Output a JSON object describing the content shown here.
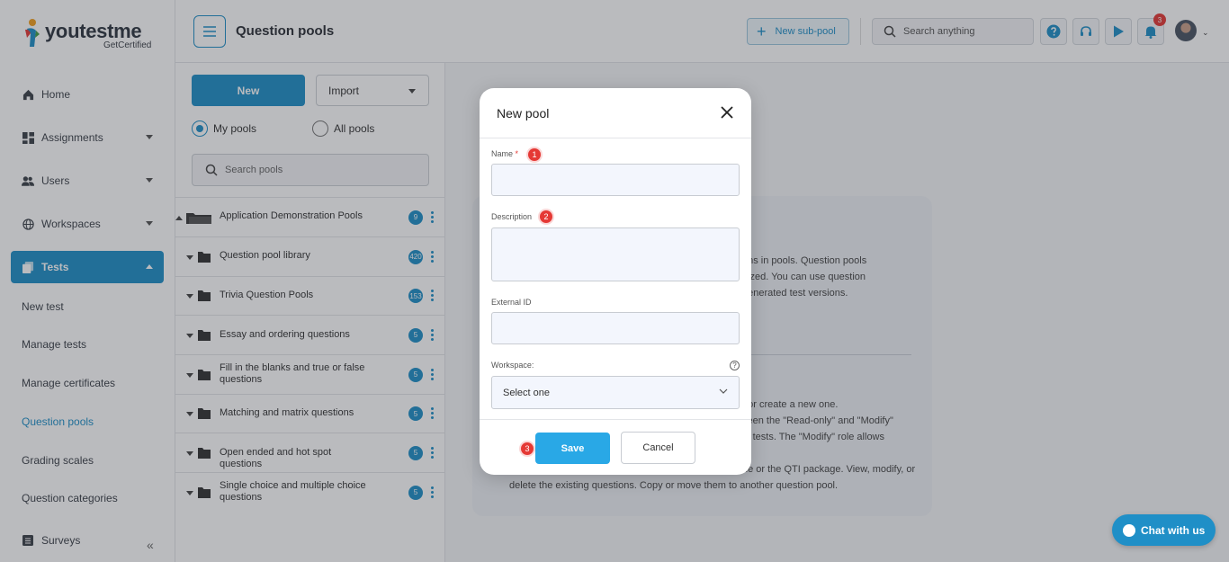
{
  "brand": {
    "name": "youtestme",
    "tagline": "GetCertified"
  },
  "header": {
    "title": "Question pools",
    "new_subpool": "New sub-pool",
    "search_placeholder": "Search anything",
    "notifications_count": "3"
  },
  "sidebar": {
    "items": [
      {
        "label": "Home"
      },
      {
        "label": "Assignments"
      },
      {
        "label": "Users"
      },
      {
        "label": "Workspaces"
      },
      {
        "label": "Tests"
      },
      {
        "label": "Surveys"
      }
    ],
    "tests_sub": [
      {
        "label": "New test"
      },
      {
        "label": "Manage tests"
      },
      {
        "label": "Manage certificates"
      },
      {
        "label": "Question pools"
      },
      {
        "label": "Grading scales"
      },
      {
        "label": "Question categories"
      }
    ]
  },
  "pools": {
    "new_label": "New",
    "import_label": "Import",
    "radio_my": "My pools",
    "radio_all": "All pools",
    "search_placeholder": "Search pools",
    "tree": [
      {
        "label": "Application Demonstration Pools",
        "count": "9"
      },
      {
        "label": "Question pool library",
        "count": "420"
      },
      {
        "label": "Trivia Question Pools",
        "count": "153"
      },
      {
        "label": "Essay and ordering questions",
        "count": "5"
      },
      {
        "label": "Fill in the blanks and true or false questions",
        "count": "5"
      },
      {
        "label": "Matching and matrix questions",
        "count": "5"
      },
      {
        "label": "Open ended and hot spot questions",
        "count": "5"
      },
      {
        "label": "Single choice and multiple choice questions",
        "count": "5"
      }
    ]
  },
  "background_info": {
    "line1": "ons in pools. Question pools",
    "line2": "nized. You can use question",
    "line3": "generated test versions.",
    "line4": "t or create a new one.",
    "line5": "veen the \"Read-only\" and \"Modify\"",
    "line6": "in tests. The \"Modify\" role allows",
    "line7": "ne or the QTI package. View, modify, or",
    "line8": "delete the existing questions. Copy or move them to another question pool."
  },
  "modal": {
    "title": "New pool",
    "name_label": "Name",
    "required_mark": "*",
    "description_label": "Description",
    "external_id_label": "External ID",
    "workspace_label": "Workspace:",
    "workspace_value": "Select one",
    "help_glyph": "?",
    "save": "Save",
    "cancel": "Cancel",
    "steps": [
      "1",
      "2",
      "3"
    ]
  },
  "chat": {
    "label": "Chat with us"
  },
  "colors": {
    "accent": "#1f8fc7",
    "save": "#29a8e6",
    "step": "#e53935"
  }
}
